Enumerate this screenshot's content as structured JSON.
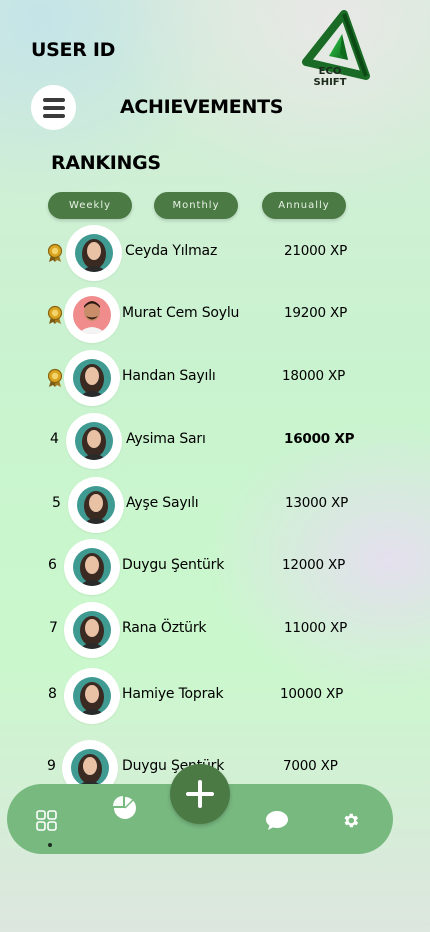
{
  "header": {
    "user_id_label": "USER ID",
    "page_title": "ACHIEVEMENTS",
    "logo": {
      "line1": "ECO",
      "line2": "SHIFT"
    }
  },
  "section_title": "RANKINGS",
  "tabs": [
    {
      "label": "Weekly"
    },
    {
      "label": "Monthly"
    },
    {
      "label": "Annually"
    }
  ],
  "rankings": [
    {
      "rank": "",
      "medal": "medal-icon",
      "name": "Ceyda Yılmaz",
      "xp": "21000 XP"
    },
    {
      "rank": "",
      "medal": "medal-icon",
      "name": "Murat Cem Soylu",
      "xp": "19200 XP"
    },
    {
      "rank": "",
      "medal": "medal-icon",
      "name": "Handan Sayılı",
      "xp": "18000 XP"
    },
    {
      "rank": "4",
      "name": "Aysima Sarı",
      "xp": "16000 XP"
    },
    {
      "rank": "5",
      "name": "Ayşe Sayılı",
      "xp": "13000 XP"
    },
    {
      "rank": "6",
      "name": "Duygu Şentürk",
      "xp": "12000 XP"
    },
    {
      "rank": "7",
      "name": "Rana Öztürk",
      "xp": "11000 XP"
    },
    {
      "rank": "8",
      "name": "Hamiye Toprak",
      "xp": "10000 XP"
    },
    {
      "rank": "9",
      "name": "Duygu Şentürk",
      "xp": "7000 XP"
    }
  ],
  "nav": {
    "items": [
      "grid-icon",
      "pie-chart-icon",
      "plus-icon",
      "chat-icon",
      "gear-icon"
    ],
    "active": "grid-icon"
  },
  "colors": {
    "accent": "#4b7a45",
    "navbar": "#78b980",
    "medal_gold": "#d9a520"
  }
}
